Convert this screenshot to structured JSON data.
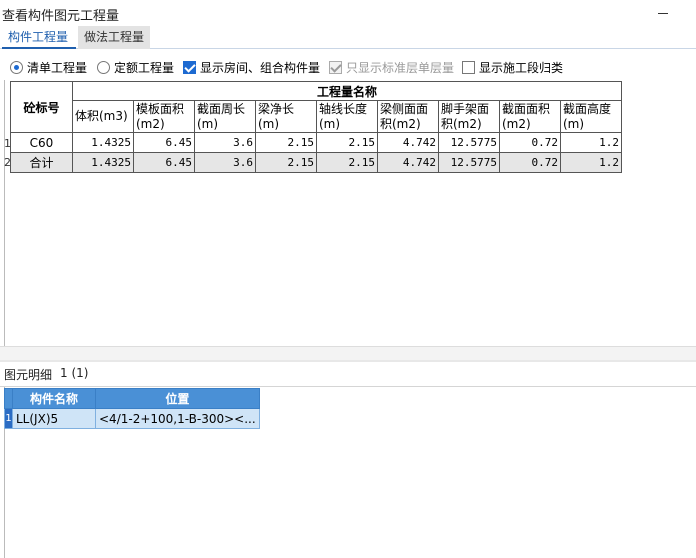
{
  "window": {
    "title": "查看构件图元工程量"
  },
  "tabs": [
    {
      "label": "构件工程量"
    },
    {
      "label": "做法工程量"
    }
  ],
  "options": {
    "qingdan": "清单工程量",
    "dinge": "定额工程量",
    "show_room": "显示房间、组合构件量",
    "std_layer": "只显示标准层单层量",
    "show_stage": "显示施工段归类"
  },
  "table": {
    "corner_header": "砼标号",
    "group_header": "工程量名称",
    "columns": [
      "体积(m3)",
      "模板面积(m2)",
      "截面周长(m)",
      "梁净长(m)",
      "轴线长度(m)",
      "梁侧面面积(m2)",
      "脚手架面积(m2)",
      "截面面积(m2)",
      "截面高度(m)"
    ],
    "rows": [
      {
        "num": "1",
        "name": "C60",
        "values": [
          "1.4325",
          "6.45",
          "3.6",
          "2.15",
          "2.15",
          "4.742",
          "12.5775",
          "0.72",
          "1.2"
        ]
      },
      {
        "num": "2",
        "name": "合计",
        "values": [
          "1.4325",
          "6.45",
          "3.6",
          "2.15",
          "2.15",
          "4.742",
          "12.5775",
          "0.72",
          "1.2"
        ]
      }
    ]
  },
  "detail": {
    "label": "图元明细",
    "count": "1 (1)",
    "columns": [
      "构件名称",
      "位置"
    ],
    "rows": [
      {
        "num": "1",
        "name": "LL(JX)5",
        "position": "<4/1-2+100,1-B-300><..."
      }
    ]
  }
}
